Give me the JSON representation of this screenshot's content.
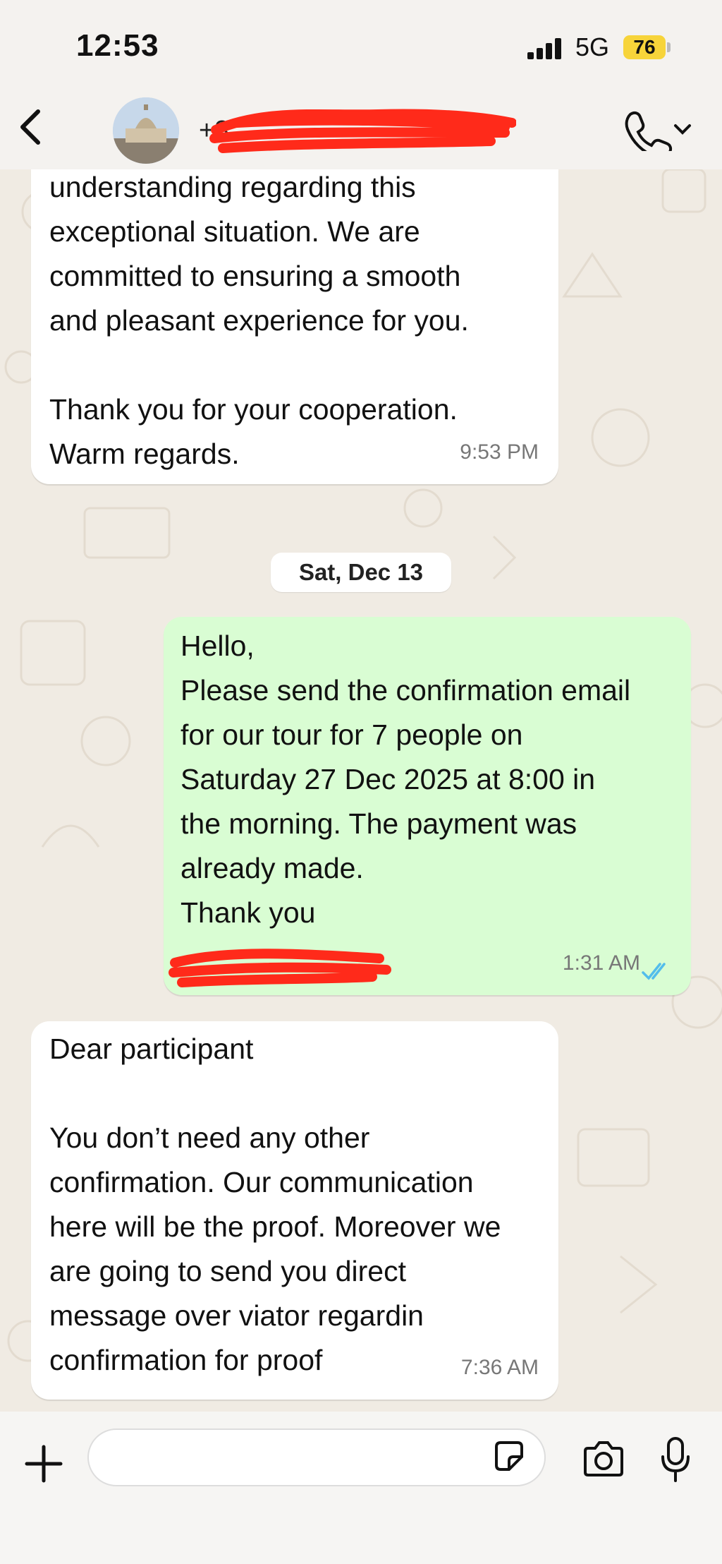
{
  "status_bar": {
    "time": "12:53",
    "network": "5G",
    "battery": "76"
  },
  "header": {
    "contact_name_partial": "+3",
    "back_icon": "chevron-left-icon",
    "call_icon": "phone-icon"
  },
  "messages": [
    {
      "direction": "incoming",
      "text": "understanding regarding this\nexceptional situation. We are\ncommitted to ensuring a smooth\nand pleasant experience for you.\n\nThank you for your cooperation.\nWarm regards.",
      "time": "9:53 PM"
    },
    {
      "type": "date",
      "label": "Sat, Dec 13"
    },
    {
      "direction": "outgoing",
      "text": "Hello,\nPlease send the confirmation email\nfor our tour for 7 people on\nSaturday 27 Dec 2025 at 8:00 in\nthe morning. The payment was\nalready made.\nThank you",
      "time": "1:31 AM",
      "status": "read"
    },
    {
      "direction": "incoming",
      "text": "Dear participant\n\nYou don’t need any other\nconfirmation. Our communication\nhere will be the proof. Moreover we\nare going to send you direct\nmessage over viator regardin\nconfirmation for proof",
      "time": "7:36 AM"
    }
  ],
  "composer": {
    "placeholder": ""
  },
  "colors": {
    "incoming_bubble": "#ffffff",
    "outgoing_bubble": "#d9fdd3",
    "read_ticks": "#53bdeb",
    "battery": "#f7d43a"
  }
}
